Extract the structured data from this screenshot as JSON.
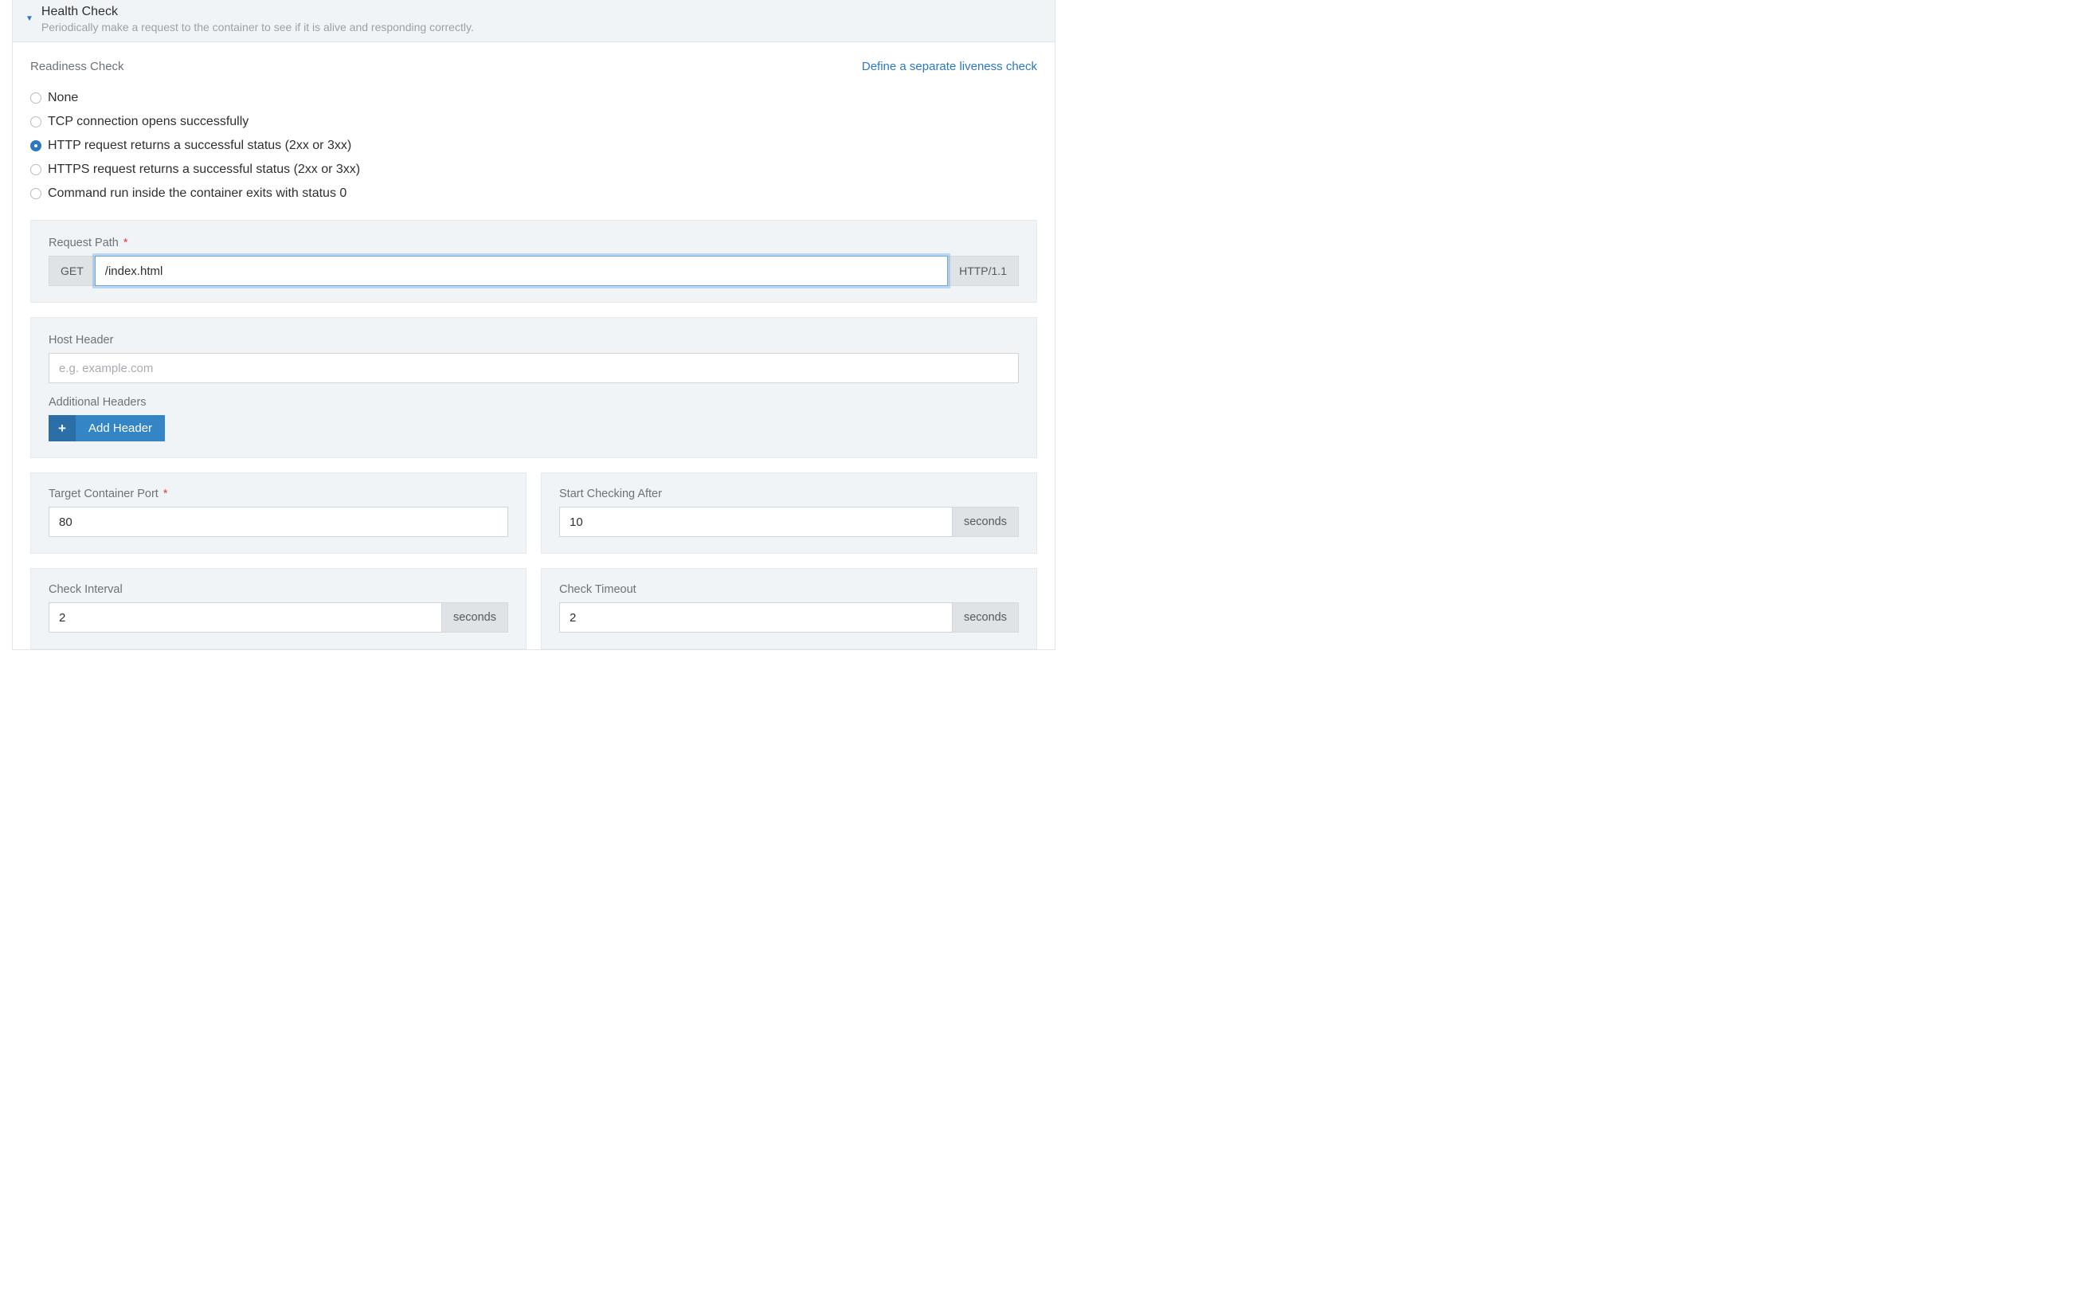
{
  "header": {
    "title": "Health Check",
    "description": "Periodically make a request to the container to see if it is alive and responding correctly."
  },
  "readiness": {
    "label": "Readiness Check",
    "define_liveness_link": "Define a separate liveness check",
    "options": {
      "none": "None",
      "tcp": "TCP connection opens successfully",
      "http": "HTTP request returns a successful status (2xx or 3xx)",
      "https": "HTTPS request returns a successful status (2xx or 3xx)",
      "cmd": "Command run inside the container exits with status 0"
    }
  },
  "request_path": {
    "label": "Request Path",
    "method": "GET",
    "value": "/index.html",
    "protocol": "HTTP/1.1"
  },
  "host_header": {
    "label": "Host Header",
    "placeholder": "e.g. example.com",
    "value": ""
  },
  "additional_headers": {
    "label": "Additional Headers",
    "add_button": "Add Header"
  },
  "target_port": {
    "label": "Target Container Port",
    "value": "80"
  },
  "start_after": {
    "label": "Start Checking After",
    "value": "10",
    "unit": "seconds"
  },
  "check_interval": {
    "label": "Check Interval",
    "value": "2",
    "unit": "seconds"
  },
  "check_timeout": {
    "label": "Check Timeout",
    "value": "2",
    "unit": "seconds"
  }
}
